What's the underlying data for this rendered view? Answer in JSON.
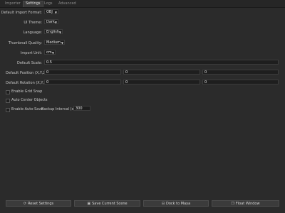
{
  "tabs": [
    "Importer",
    "Settings",
    "Logs",
    "Advanced"
  ],
  "settings": {
    "import_format": {
      "label": "Default Import Format:",
      "value": "OBJ"
    },
    "ui_theme": {
      "label": "UI Theme:",
      "value": "Dark"
    },
    "language": {
      "label": "Language:",
      "value": "English"
    },
    "thumb_quality": {
      "label": "Thumbnail Quality:",
      "value": "Medium"
    },
    "import_unit": {
      "label": "Import Unit:",
      "value": "cm"
    },
    "default_scale": {
      "label": "Default Scale:",
      "value": "0.5"
    },
    "default_position": {
      "label": "Default Position (X,Y,Z):",
      "x": "0",
      "y": "0",
      "z": "0"
    },
    "default_rotation": {
      "label": "Default Rotation (X,Y,Z):",
      "x": "0",
      "y": "0",
      "z": "0"
    },
    "grid_snap": {
      "label": "Enable Grid Snap",
      "checked": false
    },
    "auto_center": {
      "label": "Auto Center Objects",
      "checked": false
    },
    "auto_save": {
      "label": "Enable Auto-Save",
      "checked": false
    },
    "backup_interval": {
      "label": "Backup Interval (s):",
      "value": "300"
    }
  },
  "buttons": {
    "reset": "Reset Settings",
    "save_scene": "Save Current Scene",
    "dock": "Dock to Maya",
    "float": "Float Window"
  },
  "icons": {
    "reset": "refresh-icon",
    "save_scene": "save-icon",
    "dock": "dock-icon",
    "float": "float-window-icon"
  }
}
